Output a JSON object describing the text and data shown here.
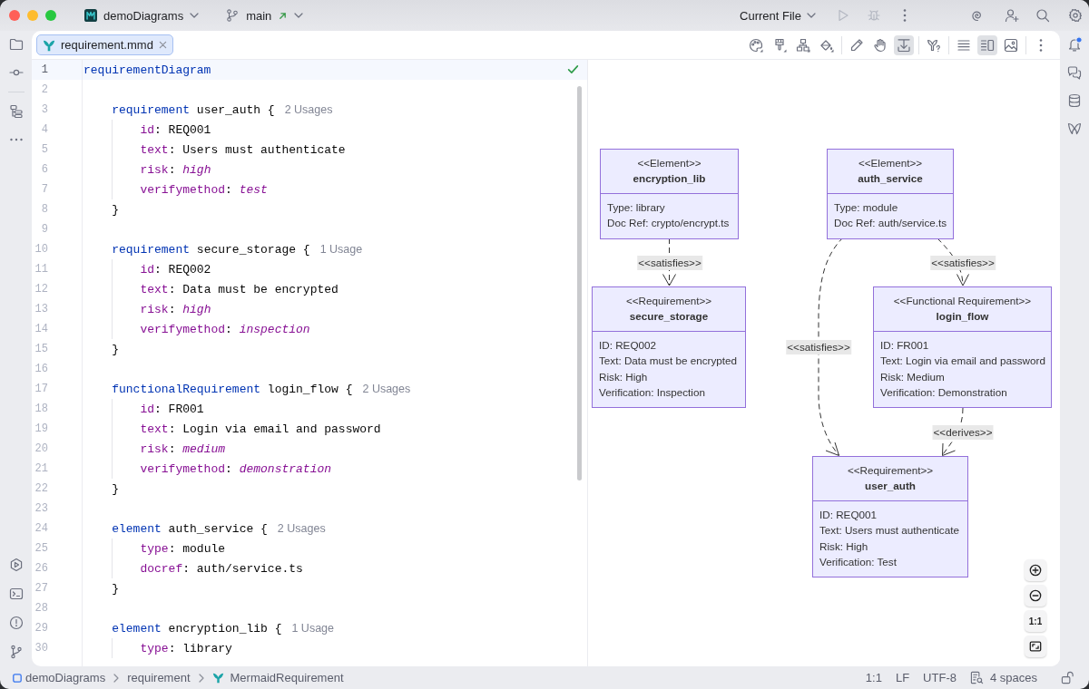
{
  "title_bar": {
    "project": {
      "name": "demoDiagrams"
    },
    "branch": {
      "name": "main"
    },
    "run_configuration": {
      "label": "Current File"
    },
    "run_actions": [
      {
        "kind": "run",
        "disabled": true
      },
      {
        "kind": "debug",
        "disabled": true
      }
    ]
  },
  "left_toolbar": {
    "top": [
      {
        "kind": "project",
        "selected": false
      },
      {
        "kind": "commit",
        "selected": false
      },
      {
        "kind": "structure",
        "selected": false
      },
      {
        "kind": "more",
        "selected": false
      }
    ],
    "bottom": [
      {
        "kind": "services",
        "selected": false
      },
      {
        "kind": "terminal",
        "selected": false
      },
      {
        "kind": "problems",
        "selected": false
      },
      {
        "kind": "git",
        "selected": false
      }
    ]
  },
  "editor": {
    "tabs": [
      {
        "label": "requirement.mmd",
        "selected": true
      }
    ],
    "toolbar": [
      [
        {
          "kind": "palette",
          "selected": false
        },
        {
          "kind": "brush",
          "selected": false
        },
        {
          "kind": "hierarchy",
          "selected": false
        },
        {
          "kind": "bucket",
          "selected": false
        }
      ],
      [
        {
          "kind": "pencil",
          "selected": false
        },
        {
          "kind": "hand",
          "selected": false
        },
        {
          "kind": "scroll",
          "selected": true
        }
      ],
      [
        {
          "kind": "help",
          "selected": false
        }
      ],
      [
        {
          "kind": "editor",
          "selected": false
        },
        {
          "kind": "split",
          "selected": true
        },
        {
          "kind": "preview",
          "selected": false
        }
      ],
      [
        {
          "kind": "more",
          "selected": false
        }
      ]
    ],
    "lines": [
      {
        "number": "1",
        "current": true,
        "tokens": [
          {
            "kind": "keyword",
            "text": "requirementDiagram"
          }
        ]
      },
      {
        "number": "2",
        "current": false
      },
      {
        "number": "3",
        "current": false,
        "tokens": [
          {
            "kind": "keyword",
            "text": "    requirement"
          },
          {
            "kind": "plain",
            "text": " user_auth {"
          }
        ],
        "hint": "2 Usages"
      },
      {
        "number": "4",
        "current": false,
        "tokens": [
          {
            "kind": "property",
            "text": "        id"
          },
          {
            "kind": "plain",
            "text": ": REQ001"
          }
        ]
      },
      {
        "number": "5",
        "current": false,
        "tokens": [
          {
            "kind": "property",
            "text": "        text"
          },
          {
            "kind": "plain",
            "text": ": Users must authenticate"
          }
        ]
      },
      {
        "number": "6",
        "current": false,
        "tokens": [
          {
            "kind": "property",
            "text": "        risk"
          },
          {
            "kind": "plain",
            "text": ": "
          },
          {
            "kind": "value",
            "text": "high"
          }
        ]
      },
      {
        "number": "7",
        "current": false,
        "tokens": [
          {
            "kind": "property",
            "text": "        verifymethod"
          },
          {
            "kind": "plain",
            "text": ": "
          },
          {
            "kind": "value",
            "text": "test"
          }
        ]
      },
      {
        "number": "8",
        "current": false,
        "tokens": [
          {
            "kind": "plain",
            "text": "    }"
          }
        ]
      },
      {
        "number": "9",
        "current": false
      },
      {
        "number": "10",
        "current": false,
        "tokens": [
          {
            "kind": "keyword",
            "text": "    requirement"
          },
          {
            "kind": "plain",
            "text": " secure_storage {"
          }
        ],
        "hint": "1 Usage"
      },
      {
        "number": "11",
        "current": false,
        "tokens": [
          {
            "kind": "property",
            "text": "        id"
          },
          {
            "kind": "plain",
            "text": ": REQ002"
          }
        ]
      },
      {
        "number": "12",
        "current": false,
        "tokens": [
          {
            "kind": "property",
            "text": "        text"
          },
          {
            "kind": "plain",
            "text": ": Data must be encrypted"
          }
        ]
      },
      {
        "number": "13",
        "current": false,
        "tokens": [
          {
            "kind": "property",
            "text": "        risk"
          },
          {
            "kind": "plain",
            "text": ": "
          },
          {
            "kind": "value",
            "text": "high"
          }
        ]
      },
      {
        "number": "14",
        "current": false,
        "tokens": [
          {
            "kind": "property",
            "text": "        verifymethod"
          },
          {
            "kind": "plain",
            "text": ": "
          },
          {
            "kind": "value",
            "text": "inspection"
          }
        ]
      },
      {
        "number": "15",
        "current": false,
        "tokens": [
          {
            "kind": "plain",
            "text": "    }"
          }
        ]
      },
      {
        "number": "16",
        "current": false
      },
      {
        "number": "17",
        "current": false,
        "tokens": [
          {
            "kind": "keyword",
            "text": "    functionalRequirement"
          },
          {
            "kind": "plain",
            "text": " login_flow {"
          }
        ],
        "hint": "2 Usages"
      },
      {
        "number": "18",
        "current": false,
        "tokens": [
          {
            "kind": "property",
            "text": "        id"
          },
          {
            "kind": "plain",
            "text": ": FR001"
          }
        ]
      },
      {
        "number": "19",
        "current": false,
        "tokens": [
          {
            "kind": "property",
            "text": "        text"
          },
          {
            "kind": "plain",
            "text": ": Login via email and password"
          }
        ]
      },
      {
        "number": "20",
        "current": false,
        "tokens": [
          {
            "kind": "property",
            "text": "        risk"
          },
          {
            "kind": "plain",
            "text": ": "
          },
          {
            "kind": "value",
            "text": "medium"
          }
        ]
      },
      {
        "number": "21",
        "current": false,
        "tokens": [
          {
            "kind": "property",
            "text": "        verifymethod"
          },
          {
            "kind": "plain",
            "text": ": "
          },
          {
            "kind": "value",
            "text": "demonstration"
          }
        ]
      },
      {
        "number": "22",
        "current": false,
        "tokens": [
          {
            "kind": "plain",
            "text": "    }"
          }
        ]
      },
      {
        "number": "23",
        "current": false
      },
      {
        "number": "24",
        "current": false,
        "tokens": [
          {
            "kind": "keyword",
            "text": "    element"
          },
          {
            "kind": "plain",
            "text": " auth_service {"
          }
        ],
        "hint": "2 Usages"
      },
      {
        "number": "25",
        "current": false,
        "tokens": [
          {
            "kind": "property",
            "text": "        type"
          },
          {
            "kind": "plain",
            "text": ": module"
          }
        ]
      },
      {
        "number": "26",
        "current": false,
        "tokens": [
          {
            "kind": "property",
            "text": "        docref"
          },
          {
            "kind": "plain",
            "text": ": auth/service.ts"
          }
        ]
      },
      {
        "number": "27",
        "current": false,
        "tokens": [
          {
            "kind": "plain",
            "text": "    }"
          }
        ]
      },
      {
        "number": "28",
        "current": false
      },
      {
        "number": "29",
        "current": false,
        "tokens": [
          {
            "kind": "keyword",
            "text": "    element"
          },
          {
            "kind": "plain",
            "text": " encryption_lib {"
          }
        ],
        "hint": "1 Usage"
      },
      {
        "number": "30",
        "current": false,
        "tokens": [
          {
            "kind": "property",
            "text": "        type"
          },
          {
            "kind": "plain",
            "text": ": library"
          }
        ]
      }
    ]
  },
  "diagram": {
    "nodes": [
      {
        "stereotype": "<<Element>>",
        "name": "encryption_lib",
        "fields": [
          "Type: library",
          "Doc Ref: crypto/encrypt.ts"
        ]
      },
      {
        "stereotype": "<<Element>>",
        "name": "auth_service",
        "fields": [
          "Type: module",
          "Doc Ref: auth/service.ts"
        ]
      },
      {
        "stereotype": "<<Requirement>>",
        "name": "secure_storage",
        "fields": [
          "ID: REQ002",
          "Text: Data must be encrypted",
          "Risk: High",
          "Verification: Inspection"
        ]
      },
      {
        "stereotype": "<<Functional Requirement>>",
        "name": "login_flow",
        "fields": [
          "ID: FR001",
          "Text: Login via email and password",
          "Risk: Medium",
          "Verification: Demonstration"
        ]
      },
      {
        "stereotype": "<<Requirement>>",
        "name": "user_auth",
        "fields": [
          "ID: REQ001",
          "Text: Users must authenticate",
          "Risk: High",
          "Verification: Test"
        ]
      }
    ],
    "edges": [
      {
        "label": "<<satisfies>>"
      },
      {
        "label": "<<satisfies>>"
      },
      {
        "label": "<<satisfies>>"
      },
      {
        "label": "<<derives>>"
      }
    ],
    "zoom_controls": [
      {
        "kind": "zoom-in"
      },
      {
        "kind": "zoom-out"
      },
      {
        "kind": "actual-size",
        "label": "1:1"
      },
      {
        "kind": "fit"
      }
    ]
  },
  "right_toolbar": [
    {
      "kind": "notifications",
      "unread": true
    },
    {
      "kind": "chat",
      "unread": false
    },
    {
      "kind": "database",
      "unread": false
    },
    {
      "kind": "logo",
      "unread": false
    }
  ],
  "status_bar": {
    "breadcrumbs": [
      {
        "kind": "project",
        "label": "demoDiagrams"
      },
      {
        "kind": "folder",
        "label": "requirement"
      },
      {
        "kind": "diagram",
        "label": "MermaidRequirement"
      }
    ],
    "items": [
      {
        "kind": "text",
        "label": "1:1"
      },
      {
        "kind": "text",
        "label": "LF"
      },
      {
        "kind": "text",
        "label": "UTF-8"
      },
      {
        "kind": "indent",
        "label": "4 spaces"
      }
    ]
  }
}
